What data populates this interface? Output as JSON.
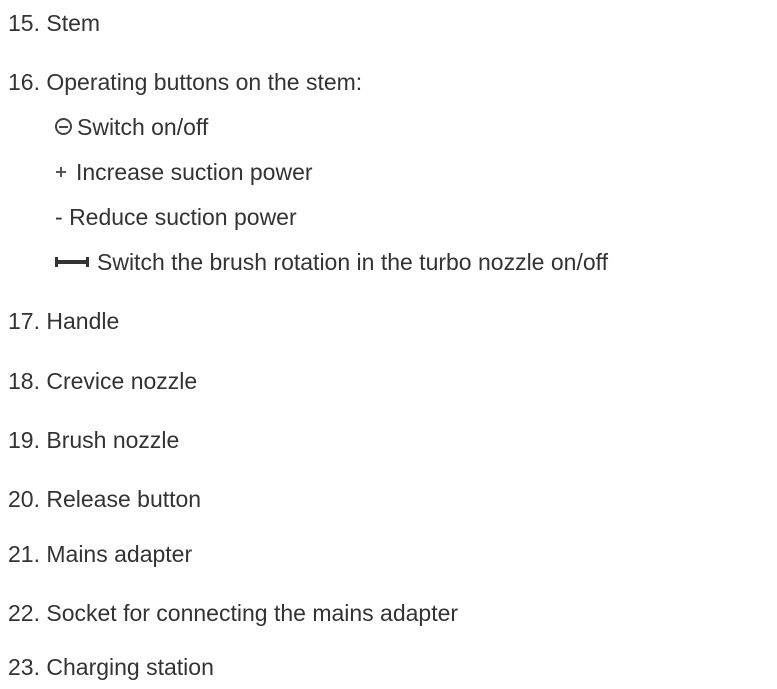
{
  "items": [
    {
      "num": "15.",
      "text": "Stem"
    },
    {
      "num": "16.",
      "text": "Operating buttons on the stem:"
    },
    {
      "num": "17.",
      "text": "Handle"
    },
    {
      "num": "18.",
      "text": "Crevice nozzle"
    },
    {
      "num": "19.",
      "text": "Brush nozzle"
    },
    {
      "num": "20.",
      "text": "Release button"
    },
    {
      "num": "21.",
      "text": "Mains adapter"
    },
    {
      "num": "22.",
      "text": "Socket for connecting the mains adapter"
    },
    {
      "num": "23.",
      "text": "Charging station"
    }
  ],
  "buttons": [
    {
      "icon": "power-onoff-icon",
      "text": "Switch on/off"
    },
    {
      "icon": "plus-icon",
      "text": "Increase suction power"
    },
    {
      "icon": "minus-text",
      "prefix": "-",
      "text": "Reduce suction power"
    },
    {
      "icon": "brush-rotation-icon",
      "text": "Switch the brush rotation in the turbo nozzle on/off"
    }
  ]
}
